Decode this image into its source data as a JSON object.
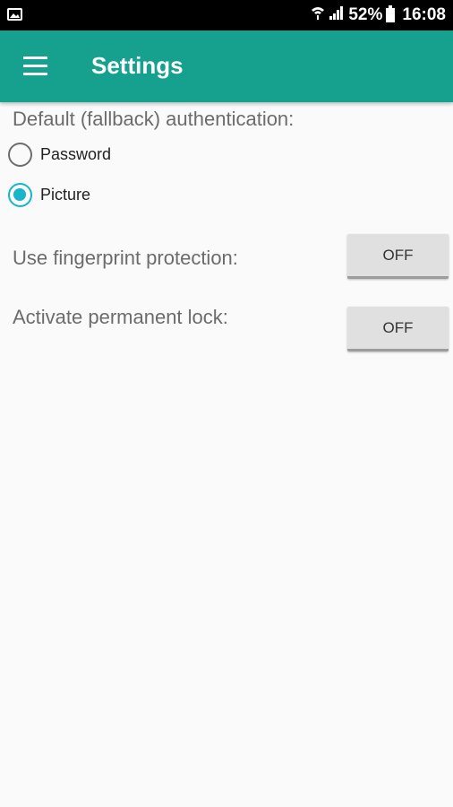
{
  "status_bar": {
    "battery": "52%",
    "time": "16:08",
    "icons": [
      "gallery-icon",
      "wifi-icon",
      "signal-icon",
      "battery-icon"
    ]
  },
  "app_bar": {
    "menu_icon": "hamburger-menu-icon",
    "title": "Settings",
    "color": "#16a08e"
  },
  "auth": {
    "label": "Default (fallback) authentication:",
    "options": [
      {
        "label": "Password",
        "selected": false
      },
      {
        "label": "Picture",
        "selected": true
      }
    ],
    "accent": "#18b4c8"
  },
  "settings": [
    {
      "label": "Use fingerprint protection:",
      "state": "OFF"
    },
    {
      "label": "Activate permanent lock:",
      "state": "OFF"
    }
  ]
}
